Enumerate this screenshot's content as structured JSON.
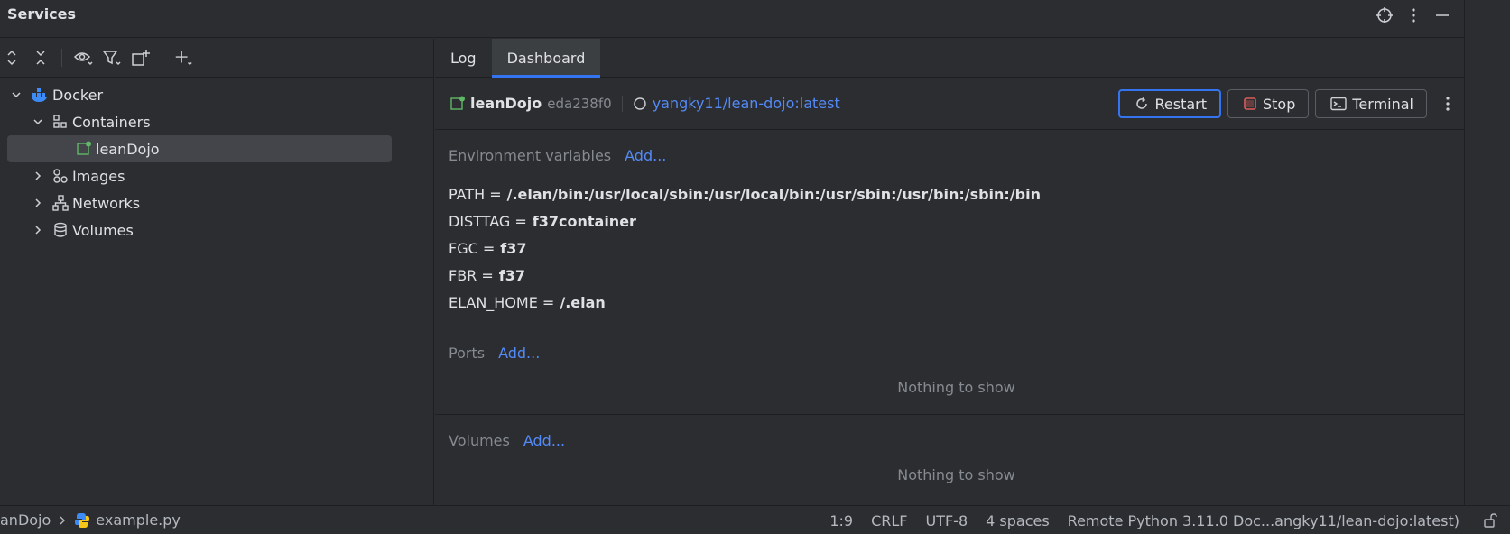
{
  "window": {
    "title": "Services"
  },
  "tree": {
    "root": {
      "label": "Docker"
    },
    "containers": {
      "label": "Containers"
    },
    "container_item": {
      "label": "leanDojo"
    },
    "images": {
      "label": "Images"
    },
    "networks": {
      "label": "Networks"
    },
    "volumes": {
      "label": "Volumes"
    }
  },
  "tabs": [
    {
      "label": "Log"
    },
    {
      "label": "Dashboard"
    }
  ],
  "header": {
    "container_name": "leanDojo",
    "container_id": "eda238f0",
    "image": "yangky11/lean-dojo:latest",
    "buttons": {
      "restart": "Restart",
      "stop": "Stop",
      "terminal": "Terminal"
    }
  },
  "env_section": {
    "label": "Environment variables",
    "add": "Add...",
    "vars": [
      {
        "key": "PATH =",
        "value": "/.elan/bin:/usr/local/sbin:/usr/local/bin:/usr/sbin:/usr/bin:/sbin:/bin"
      },
      {
        "key": "DISTTAG =",
        "value": "f37container"
      },
      {
        "key": "FGC =",
        "value": "f37"
      },
      {
        "key": "FBR =",
        "value": "f37"
      },
      {
        "key": "ELAN_HOME =",
        "value": "/.elan"
      }
    ]
  },
  "ports_section": {
    "label": "Ports",
    "add": "Add...",
    "empty": "Nothing to show"
  },
  "volumes_section": {
    "label": "Volumes",
    "add": "Add...",
    "empty": "Nothing to show"
  },
  "status": {
    "crumb_project": "anDojo",
    "crumb_file": "example.py",
    "position": "1:9",
    "line_ending": "CRLF",
    "encoding": "UTF-8",
    "indent": "4 spaces",
    "interpreter": "Remote Python 3.11.0 Doc...angky11/lean-dojo:latest)"
  },
  "colors": {
    "accent": "#3574f0",
    "link": "#548af7",
    "running": "#5fb865",
    "stop": "#db5c5c",
    "docker": "#3d8bf6"
  }
}
